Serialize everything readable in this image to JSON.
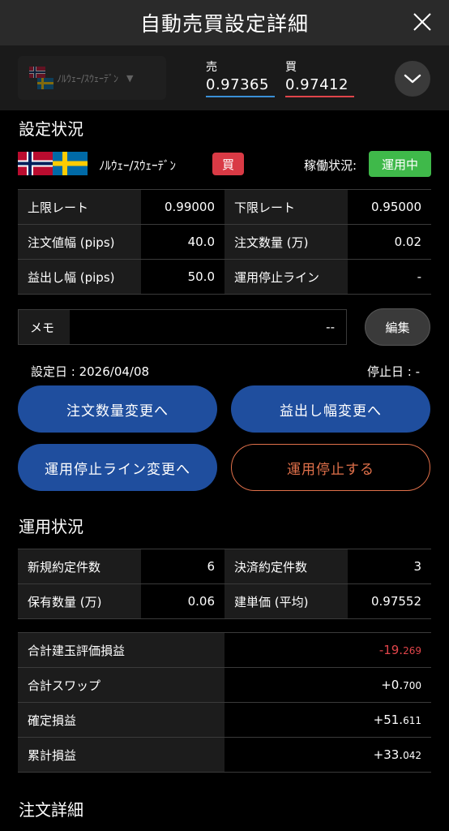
{
  "header": {
    "title": "自動売買設定詳細"
  },
  "pair_bar": {
    "selector_label": "ﾉﾙｳｪｰ/ｽｳｪｰﾃﾞﾝ",
    "sell_label": "売",
    "sell_rate": "0.97365",
    "buy_label": "買",
    "buy_rate": "0.97412"
  },
  "settings": {
    "section_title": "設定状況",
    "pair_name": "ﾉﾙｳｪｰ/ｽｳｪｰﾃﾞﾝ",
    "side": "買",
    "status_label": "稼働状況:",
    "status": "運用中",
    "rows": [
      {
        "l1": "上限レート",
        "v1": "0.99000",
        "l2": "下限レート",
        "v2": "0.95000"
      },
      {
        "l1": "注文値幅 (pips)",
        "v1": "40.0",
        "l2": "注文数量 (万)",
        "v2": "0.02"
      },
      {
        "l1": "益出し幅 (pips)",
        "v1": "50.0",
        "l2": "運用停止ライン",
        "v2": "-"
      }
    ],
    "memo_label": "メモ",
    "memo_value": "--",
    "edit_label": "編集",
    "set_date": "設定日 : 2026/04/08",
    "stop_date": "停止日 : -"
  },
  "actions": {
    "change_qty": "注文数量変更へ",
    "change_profit": "益出し幅変更へ",
    "change_stop": "運用停止ライン変更へ",
    "stop": "運用停止する"
  },
  "operation": {
    "section_title": "運用状況",
    "rows": [
      {
        "l1": "新規約定件数",
        "v1": "6",
        "l2": "決済約定件数",
        "v2": "3"
      },
      {
        "l1": "保有数量 (万)",
        "v1": "0.06",
        "l2": "建単価 (平均)",
        "v2": "0.97552"
      }
    ],
    "pnl": [
      {
        "label": "合計建玉評価損益",
        "main": "-19.",
        "frac": "269",
        "negative": true
      },
      {
        "label": "合計スワップ",
        "main": "+0.",
        "frac": "700",
        "negative": false
      },
      {
        "label": "確定損益",
        "main": "+51.",
        "frac": "611",
        "negative": false
      },
      {
        "label": "累計損益",
        "main": "+33.",
        "frac": "042",
        "negative": false
      }
    ]
  },
  "order_detail": {
    "section_title": "注文詳細"
  },
  "colors": {
    "sell_accent": "#3a8fd6",
    "buy_accent": "#e0454a",
    "status_green": "#3fb94a",
    "action_blue": "#1f4e9e",
    "stop_orange": "#e0704a"
  }
}
